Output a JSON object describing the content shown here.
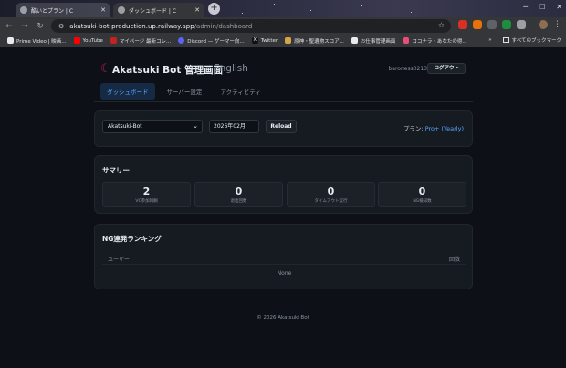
{
  "browser": {
    "tabs": [
      {
        "title": "酷いとプラン | C",
        "active": false
      },
      {
        "title": "ダッシュボード | C",
        "active": true
      }
    ],
    "url_host": "akatsuki-bot-production.up.railway.app",
    "url_path": "/admin/dashboard",
    "bookmarks": [
      "Prime Video | 映画...",
      "YouTube",
      "マイページ 最新コレ...",
      "Discord — ゲーマー向...",
      "Twitter",
      "原神・聖遺物スコア...",
      "お仕事管理画面",
      "ココナラ・あなたの得..."
    ],
    "bookmarks_right": "すべてのブックマーク"
  },
  "header": {
    "brand": "Akatsuki Bot 管理画面",
    "sub": "English",
    "username": "baroness0213",
    "logout_label": "ログアウト"
  },
  "nav": {
    "tabs": [
      {
        "label": "ダッシュボード",
        "active": true
      },
      {
        "label": "サーバー設定",
        "active": false
      },
      {
        "label": "アクティビティ",
        "active": false
      }
    ]
  },
  "controls": {
    "server_select": "Akatsuki-Bot",
    "month": "2026年02月",
    "reload_label": "Reload",
    "plan_label": "プラン:",
    "plan_value": "Pro+ (Yearly)"
  },
  "summary": {
    "title": "サマリー",
    "stats": [
      {
        "value": "2",
        "label": "VC参加報酬"
      },
      {
        "value": "0",
        "label": "退出回数"
      },
      {
        "value": "0",
        "label": "タイムアウト実行"
      },
      {
        "value": "0",
        "label": "NG検知数"
      }
    ]
  },
  "ranking": {
    "title": "NG連発ランキング",
    "col_user": "ユーザー",
    "col_count": "回数",
    "empty": "None"
  },
  "footer": "© 2026 Akatsuki Bot",
  "colors": {
    "accent": "#58a6ff",
    "brand_moon": "#c2185b",
    "background": "#0d1117",
    "card": "#161b22"
  }
}
